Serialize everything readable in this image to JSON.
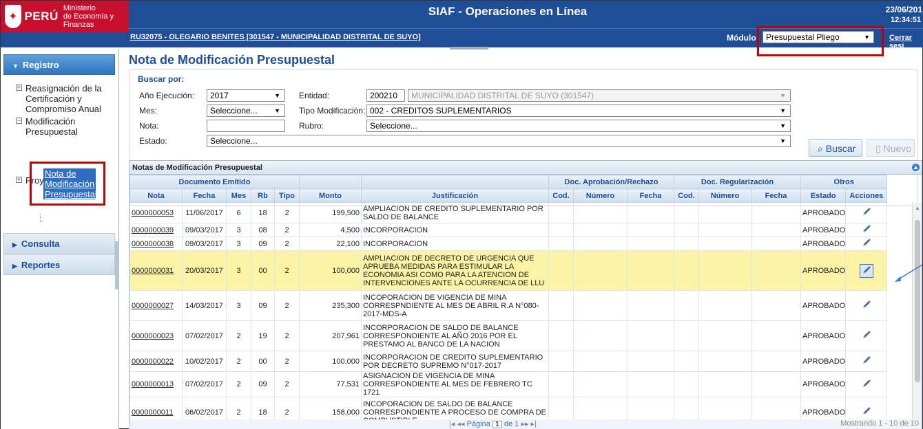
{
  "header": {
    "logo_text": "PERÚ",
    "ministry_line1": "Ministerio",
    "ministry_line2": "de Economía y Finanzas",
    "app_title": "SIAF - Operaciones en Línea",
    "date": "23/06/201",
    "time": "12:34:51",
    "user_info": "RU32075 - OLEGARIO BENITES [301547 - MUNICIPALIDAD DISTRITAL DE SUYO]",
    "modulo_label": "Módulo",
    "modulo_value": "Presupuestal Pliego",
    "logout_label": "Cerrar sesi"
  },
  "sidebar": {
    "sections": [
      {
        "label": "Registro",
        "expanded": true
      },
      {
        "label": "Consulta",
        "expanded": false
      },
      {
        "label": "Reportes",
        "expanded": false
      }
    ],
    "tree": [
      {
        "label": "Reasignación de la Certificación y Compromiso Anual",
        "toggle": "+"
      },
      {
        "label": "Modificación Presupuestal",
        "toggle": "−"
      },
      {
        "label": "Proyectos",
        "toggle": "+"
      }
    ],
    "selected_leaf": "Nota de Modificación Presupuestal"
  },
  "page": {
    "title": "Nota de Modificación Presupuestal"
  },
  "filters": {
    "legend": "Buscar por:",
    "anio_label": "Año Ejecución:",
    "anio_value": "2017",
    "mes_label": "Mes:",
    "mes_value": "Seleccione...",
    "nota_label": "Nota:",
    "nota_value": "",
    "estado_label": "Estado:",
    "estado_value": "Seleccione...",
    "entidad_label": "Entidad:",
    "entidad_code": "200210",
    "entidad_name": "MUNICIPALIDAD DISTRITAL DE SUYO (301547)",
    "tipo_label": "Tipo Modificación:",
    "tipo_value": "002 - CREDITOS SUPLEMENTARIOS",
    "rubro_label": "Rubro:",
    "rubro_value": "Seleccione...",
    "buscar_label": "Buscar",
    "nuevo_label": "Nuevo"
  },
  "grid": {
    "caption": "Notas de Modificación Presupuestal",
    "group_headers": {
      "doc_emitido": "Documento Emitido",
      "doc_aprob": "Doc. Aprobación/Rechazo",
      "doc_reg": "Doc. Regularización",
      "otros": "Otros"
    },
    "columns": [
      "Nota",
      "Fecha",
      "Mes",
      "Rb",
      "Tipo",
      "Monto",
      "Justificación",
      "Cod.",
      "Número",
      "Fecha",
      "Cod.",
      "Número",
      "Fecha",
      "Estado",
      "Acciones"
    ],
    "rows": [
      {
        "nota": "0000000053",
        "fecha": "11/06/2017",
        "mes": "6",
        "rb": "18",
        "tipo": "2",
        "monto": "199,500",
        "just": "AMPLIACION DE CREDITO SUPLEMENTARIO POR SALDO DE BALANCE",
        "estado": "APROBADO"
      },
      {
        "nota": "0000000039",
        "fecha": "09/03/2017",
        "mes": "3",
        "rb": "08",
        "tipo": "2",
        "monto": "4,500",
        "just": "INCORPORACION",
        "estado": "APROBADO"
      },
      {
        "nota": "0000000038",
        "fecha": "09/03/2017",
        "mes": "3",
        "rb": "09",
        "tipo": "2",
        "monto": "22,100",
        "just": "INCORPORACION",
        "estado": "APROBADO"
      },
      {
        "nota": "0000000031",
        "fecha": "20/03/2017",
        "mes": "3",
        "rb": "00",
        "tipo": "2",
        "monto": "100,000",
        "just": "AMPLIACION DE DECRETO DE URGENCIA QUE APRUEBA MEDIDAS PARA ESTIMULAR LA ECONOMIA ASI COMO PARA LA ATENCION DE INTERVENCIONES ANTE LA OCURRENCIA DE LLU",
        "estado": "APROBADO"
      },
      {
        "nota": "0000000027",
        "fecha": "14/03/2017",
        "mes": "3",
        "rb": "09",
        "tipo": "2",
        "monto": "235,300",
        "just": "INCOPORACION DE VIGENCIA DE MINA CORRESPNDIENTE AL MES DE ABRIL R.A N°080-2017-MDS-A",
        "estado": "APROBADO"
      },
      {
        "nota": "0000000023",
        "fecha": "07/02/2017",
        "mes": "2",
        "rb": "19",
        "tipo": "2",
        "monto": "207,961",
        "just": "INCORPORACION DE SALDO DE BALANCE CORRESPONDIENTE AL AÑO 2016 POR EL PRESTAMO AL BANCO DE LA NACION",
        "estado": "APROBADO"
      },
      {
        "nota": "0000000022",
        "fecha": "10/02/2017",
        "mes": "2",
        "rb": "00",
        "tipo": "2",
        "monto": "100,000",
        "just": "INCORPORACION DE CREDITO SUPLEMENTARIO POR DECRETO SUPREMO N°017-2017",
        "estado": "APROBADO"
      },
      {
        "nota": "0000000013",
        "fecha": "07/02/2017",
        "mes": "2",
        "rb": "09",
        "tipo": "2",
        "monto": "77,531",
        "just": "ASIGNACION DE VIGENCIA DE MINA CORRESPONDIENTE AL MES DE FEBRERO TC 1721",
        "estado": "APROBADO"
      },
      {
        "nota": "0000000011",
        "fecha": "06/02/2017",
        "mes": "2",
        "rb": "18",
        "tipo": "2",
        "monto": "158,000",
        "just": "INCOPORACION DE SALDO DE BALANCE CORRESPONDIENTE A PROCESO DE COMPRA DE COMBUSTIBLE",
        "estado": "APROBADO"
      }
    ],
    "pager": {
      "page_label": "Página",
      "page_value": "1",
      "of_label": "de 1",
      "summary": "Mostrando 1 - 10 de 10"
    }
  },
  "colors": {
    "header_blue": "#1f4e96",
    "highlight_row": "#fbf3a5",
    "annotation_red": "#c00000"
  }
}
